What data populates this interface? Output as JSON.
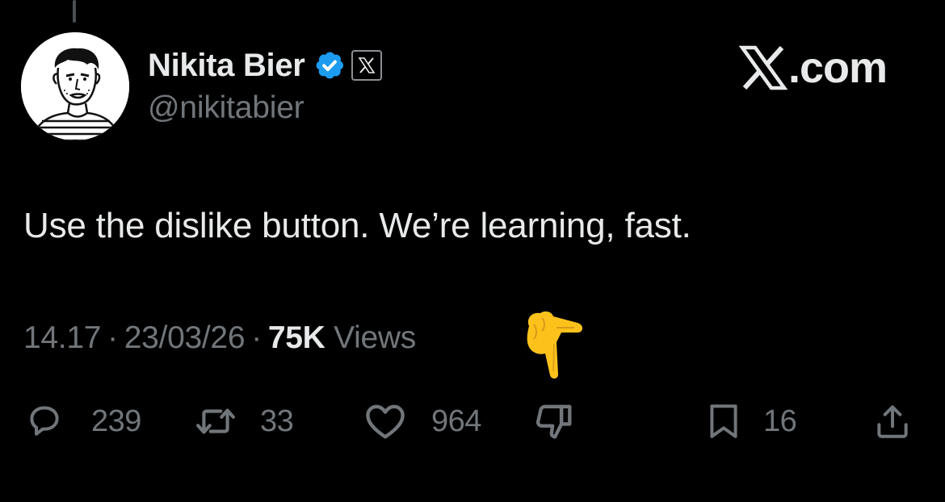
{
  "author": {
    "display_name": "Nikita Bier",
    "handle": "@nikitabier"
  },
  "brand": {
    "text": ".com"
  },
  "tweet": {
    "text": "Use the dislike button. We’re learning, fast."
  },
  "meta": {
    "time": "14.17",
    "date": "23/03/26",
    "views_count": "75K",
    "views_label": "Views",
    "separator": "·"
  },
  "actions": {
    "replies": "239",
    "reposts": "33",
    "likes": "964",
    "bookmarks": "16"
  },
  "icons": {
    "reply": "speech-bubble-icon",
    "repost": "repost-arrows-icon",
    "like": "heart-icon",
    "dislike": "thumbs-down-icon",
    "bookmark": "bookmark-icon",
    "share": "share-upload-icon",
    "verified": "verified-badge-icon",
    "pointer": "backhand-index-pointing-down-emoji"
  },
  "colors": {
    "background": "#000000",
    "primary_text": "#e7e9ea",
    "secondary_text": "#71767b",
    "verified_blue": "#1d9bf0",
    "emoji_yellow": "#fcc21b"
  }
}
